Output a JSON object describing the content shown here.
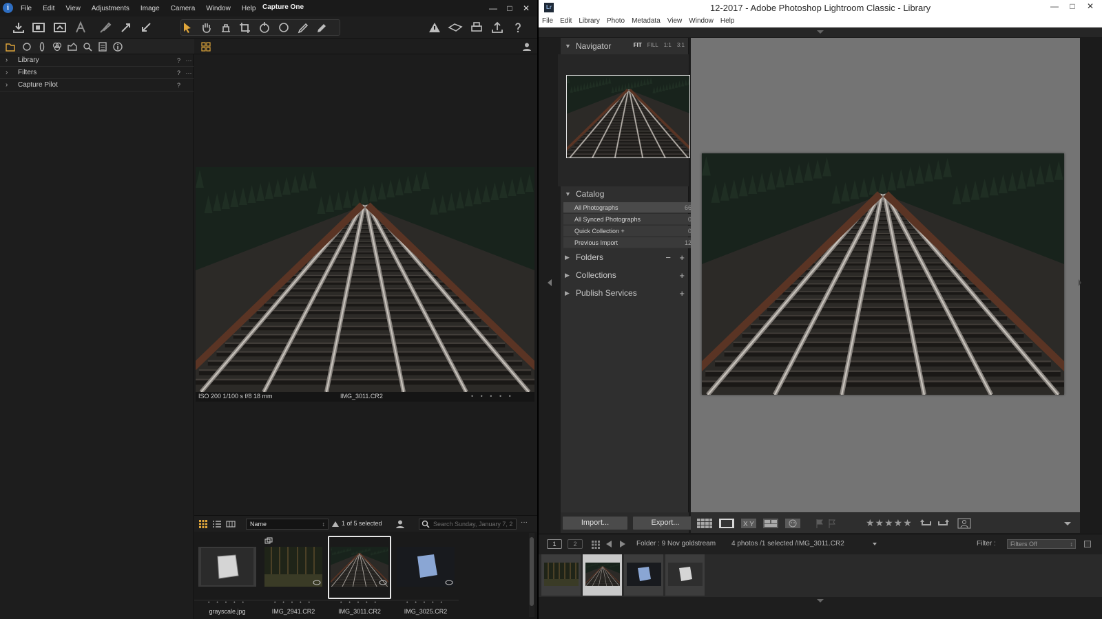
{
  "c1": {
    "menu": [
      "File",
      "Edit",
      "View",
      "Adjustments",
      "Image",
      "Camera",
      "Window",
      "Help"
    ],
    "title": "Capture One",
    "panels": [
      {
        "label": "Library",
        "help": "?",
        "more": "···"
      },
      {
        "label": "Filters",
        "help": "?",
        "more": "···"
      },
      {
        "label": "Capture Pilot",
        "help": "?",
        "more": ""
      }
    ],
    "viewer": {
      "exif": "ISO 200  1/100 s  f/8  18 mm",
      "filename": "IMG_3011.CR2"
    },
    "browser": {
      "sort_value": "Name",
      "selection": "1 of 5 selected",
      "search_placeholder": "Search Sunday, January 7, 2",
      "thumbs": [
        {
          "name": "grayscale.jpg"
        },
        {
          "name": "IMG_2941.CR2"
        },
        {
          "name": "IMG_3011.CR2"
        },
        {
          "name": "IMG_3025.CR2"
        }
      ],
      "stars": "• • • • •"
    }
  },
  "lr": {
    "title": "12-2017 - Adobe Photoshop Lightroom Classic - Library",
    "app_icon": "Lr",
    "menu": [
      "File",
      "Edit",
      "Library",
      "Photo",
      "Metadata",
      "View",
      "Window",
      "Help"
    ],
    "navigator": {
      "label": "Navigator",
      "opts": [
        "FIT",
        "FILL",
        "1:1",
        "3:1"
      ]
    },
    "catalog": {
      "label": "Catalog",
      "rows": [
        {
          "label": "All Photographs",
          "count": "66"
        },
        {
          "label": "All Synced Photographs",
          "count": "0"
        },
        {
          "label": "Quick Collection  +",
          "count": "0"
        },
        {
          "label": "Previous Import",
          "count": "12"
        }
      ]
    },
    "folders_label": "Folders",
    "collections_label": "Collections",
    "publish_label": "Publish Services",
    "import_label": "Import...",
    "export_label": "Export...",
    "stars": "★★★★★",
    "filmbar": {
      "page1": "1",
      "page2": "2",
      "source": "Folder : 9 Nov  goldstream",
      "count": "4 photos /1 selected /IMG_3011.CR2",
      "filter_label": "Filter :",
      "filter_value": "Filters Off"
    }
  },
  "icons": {
    "minimize": "—",
    "maximize": "□",
    "close": "✕"
  }
}
